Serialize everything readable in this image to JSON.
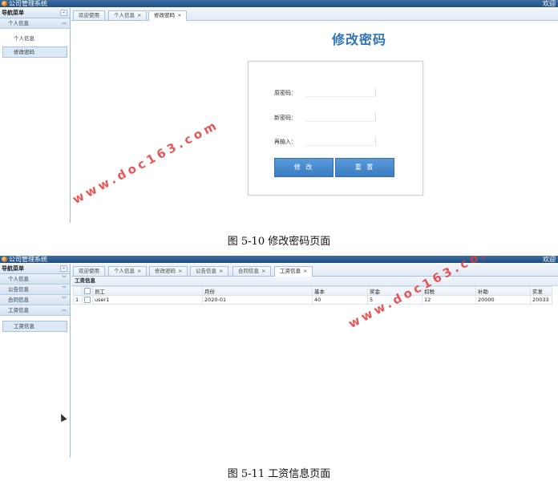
{
  "shot1": {
    "window_title": "公司管理系统",
    "title_right": "欢迎",
    "nav_header": "导航菜单",
    "nav_groups": [
      {
        "label": "个人信息",
        "chevron": "^"
      }
    ],
    "nav_items": [
      {
        "label": "个人信息",
        "active": false
      },
      {
        "label": "修改密码",
        "active": true
      }
    ],
    "tabs": [
      {
        "label": "欢迎使用",
        "closable": false,
        "active": false
      },
      {
        "label": "个人信息",
        "closable": true,
        "active": false
      },
      {
        "label": "修改密码",
        "closable": true,
        "active": true
      }
    ],
    "page_title": "修改密码",
    "form": {
      "old_label": "原密码：",
      "new_label": "新密码：",
      "confirm_label": "再输入：",
      "old_value": "",
      "new_value": "",
      "confirm_value": "",
      "submit_label": "修 改",
      "reset_label": "重 置"
    }
  },
  "caption1": "图 5-10 修改密码页面",
  "shot2": {
    "window_title": "公司管理系统",
    "title_right": "欢迎",
    "nav_header": "导航菜单",
    "nav_groups": [
      {
        "label": "个人信息",
        "chevron": "v"
      },
      {
        "label": "公告信息",
        "chevron": "v"
      },
      {
        "label": "合同信息",
        "chevron": "v"
      },
      {
        "label": "工资信息",
        "chevron": "^"
      }
    ],
    "nav_items": [
      {
        "label": "工资信息",
        "active": true
      }
    ],
    "tabs": [
      {
        "label": "欢迎使用",
        "closable": false,
        "active": false
      },
      {
        "label": "个人信息",
        "closable": true,
        "active": false
      },
      {
        "label": "修改密码",
        "closable": true,
        "active": false
      },
      {
        "label": "公告信息",
        "closable": true,
        "active": false
      },
      {
        "label": "合同信息",
        "closable": true,
        "active": false
      },
      {
        "label": "工资信息",
        "closable": true,
        "active": true
      }
    ],
    "panel_title": "工资信息",
    "table": {
      "columns": [
        "员工",
        "月份",
        "基本",
        "奖金",
        "扣税",
        "补助",
        "实发"
      ],
      "rows": [
        {
          "index": "1",
          "cells": [
            "user1",
            "2020-01",
            "40",
            "5",
            "12",
            "20000",
            "20033"
          ]
        }
      ]
    }
  },
  "caption2": "图 5-11 工资信息页面",
  "watermark": "www.doc163.com",
  "colors": {
    "titlebar": "#1f4e82",
    "accent": "#2f73b8",
    "button": "#3a7cc3",
    "watermark": "#e23b3b"
  }
}
